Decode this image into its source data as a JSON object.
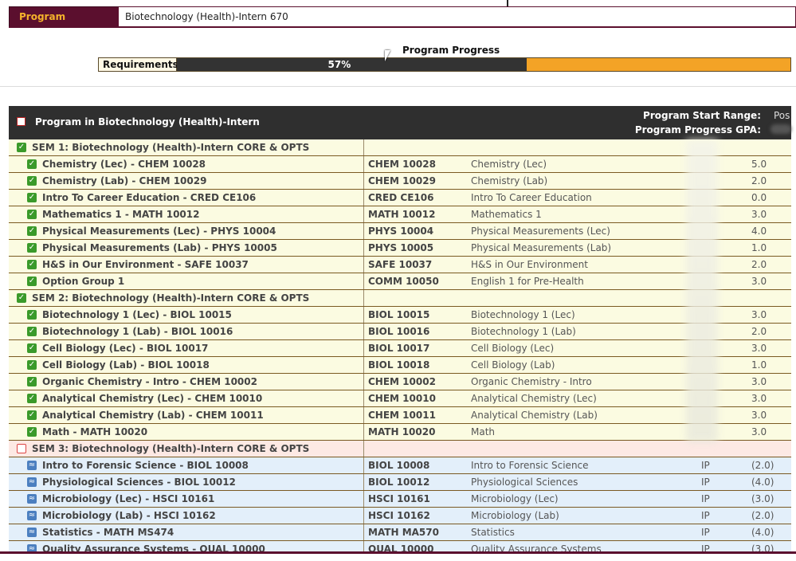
{
  "program": {
    "label": "Program",
    "value": "Biotechnology (Health)-Intern 670"
  },
  "progress": {
    "title": "Program Progress",
    "requirements_label": "Requirements",
    "percent_text": "57%",
    "percent": 57
  },
  "table": {
    "header": {
      "title": "Program in Biotechnology (Health)-Intern",
      "start_range_label": "Program Start Range:",
      "start_range_value": "Pos",
      "gpa_label": "Program Progress GPA:"
    },
    "rows": [
      {
        "type": "group",
        "status": "ok",
        "name": "SEM 1: Biotechnology (Health)-Intern CORE & OPTS"
      },
      {
        "type": "course",
        "status": "ok",
        "name": "Chemistry (Lec) - CHEM 10028",
        "code": "CHEM 10028",
        "title": "Chemistry (Lec)",
        "grade": "",
        "credits": "5.0"
      },
      {
        "type": "course",
        "status": "ok",
        "name": "Chemistry (Lab) - CHEM 10029",
        "code": "CHEM 10029",
        "title": "Chemistry (Lab)",
        "grade": "",
        "credits": "2.0"
      },
      {
        "type": "course",
        "status": "ok",
        "name": "Intro To Career Education - CRED CE106",
        "code": "CRED CE106",
        "title": "Intro To Career Education",
        "grade": "",
        "credits": "0.0"
      },
      {
        "type": "course",
        "status": "ok",
        "name": "Mathematics 1 - MATH 10012",
        "code": "MATH 10012",
        "title": "Mathematics 1",
        "grade": "",
        "credits": "3.0"
      },
      {
        "type": "course",
        "status": "ok",
        "name": "Physical Measurements (Lec) - PHYS 10004",
        "code": "PHYS 10004",
        "title": "Physical Measurements (Lec)",
        "grade": "",
        "credits": "4.0"
      },
      {
        "type": "course",
        "status": "ok",
        "name": "Physical Measurements (Lab) - PHYS 10005",
        "code": "PHYS 10005",
        "title": "Physical Measurements (Lab)",
        "grade": "",
        "credits": "1.0"
      },
      {
        "type": "course",
        "status": "ok",
        "name": "H&S in Our Environment - SAFE 10037",
        "code": "SAFE 10037",
        "title": "H&S in Our Environment",
        "grade": "",
        "credits": "2.0"
      },
      {
        "type": "course",
        "status": "ok",
        "name": "Option Group 1",
        "code": "COMM 10050",
        "title": "English 1 for Pre-Health",
        "grade": "",
        "credits": "3.0"
      },
      {
        "type": "group",
        "status": "ok",
        "name": "SEM 2: Biotechnology (Health)-Intern CORE & OPTS"
      },
      {
        "type": "course",
        "status": "ok",
        "name": "Biotechnology 1 (Lec) - BIOL 10015",
        "code": "BIOL 10015",
        "title": "Biotechnology 1 (Lec)",
        "grade": "",
        "credits": "3.0"
      },
      {
        "type": "course",
        "status": "ok",
        "name": "Biotechnology 1 (Lab) - BIOL 10016",
        "code": "BIOL 10016",
        "title": "Biotechnology 1 (Lab)",
        "grade": "",
        "credits": "2.0"
      },
      {
        "type": "course",
        "status": "ok",
        "name": "Cell Biology (Lec) - BIOL 10017",
        "code": "BIOL 10017",
        "title": "Cell Biology (Lec)",
        "grade": "",
        "credits": "3.0"
      },
      {
        "type": "course",
        "status": "ok",
        "name": "Cell Biology (Lab) - BIOL 10018",
        "code": "BIOL 10018",
        "title": "Cell Biology (Lab)",
        "grade": "",
        "credits": "1.0"
      },
      {
        "type": "course",
        "status": "ok",
        "name": "Organic Chemistry - Intro - CHEM 10002",
        "code": "CHEM 10002",
        "title": "Organic Chemistry - Intro",
        "grade": "",
        "credits": "3.0"
      },
      {
        "type": "course",
        "status": "ok",
        "name": "Analytical Chemistry (Lec) - CHEM 10010",
        "code": "CHEM 10010",
        "title": "Analytical Chemistry (Lec)",
        "grade": "",
        "credits": "3.0"
      },
      {
        "type": "course",
        "status": "ok",
        "name": "Analytical Chemistry (Lab) - CHEM 10011",
        "code": "CHEM 10011",
        "title": "Analytical Chemistry (Lab)",
        "grade": "",
        "credits": "3.0"
      },
      {
        "type": "course",
        "status": "ok",
        "name": "Math - MATH 10020",
        "code": "MATH 10020",
        "title": "Math",
        "grade": "",
        "credits": "3.0"
      },
      {
        "type": "group",
        "status": "no",
        "name": "SEM 3: Biotechnology (Health)-Intern CORE & OPTS"
      },
      {
        "type": "course",
        "status": "ip",
        "name": "Intro to Forensic Science - BIOL 10008",
        "code": "BIOL 10008",
        "title": "Intro to Forensic Science",
        "grade": "IP",
        "credits": "(2.0)"
      },
      {
        "type": "course",
        "status": "ip",
        "name": "Physiological Sciences - BIOL 10012",
        "code": "BIOL 10012",
        "title": "Physiological Sciences",
        "grade": "IP",
        "credits": "(4.0)"
      },
      {
        "type": "course",
        "status": "ip",
        "name": "Microbiology (Lec) - HSCI 10161",
        "code": "HSCI 10161",
        "title": "Microbiology (Lec)",
        "grade": "IP",
        "credits": "(3.0)"
      },
      {
        "type": "course",
        "status": "ip",
        "name": "Microbiology (Lab) - HSCI 10162",
        "code": "HSCI 10162",
        "title": "Microbiology (Lab)",
        "grade": "IP",
        "credits": "(2.0)"
      },
      {
        "type": "course",
        "status": "ip",
        "name": "Statistics - MATH MS474",
        "code": "MATH MA570",
        "title": "Statistics",
        "grade": "IP",
        "credits": "(4.0)"
      },
      {
        "type": "course",
        "status": "ip",
        "name": "Quality Assurance Systems - QUAL 10000",
        "code": "QUAL 10000",
        "title": "Quality Assurance Systems",
        "grade": "IP",
        "credits": "(3.0)"
      }
    ]
  },
  "colors": {
    "maroon": "#5b0f2e",
    "gold": "#f3a326",
    "dark_fill": "#333333",
    "row_yellow": "#fbfbe1",
    "row_pink": "#fde9e4",
    "row_blue": "#e3effa"
  },
  "icons": {
    "ok": "check-icon",
    "no": "unchecked-box-icon",
    "ip": "in-progress-icon"
  }
}
